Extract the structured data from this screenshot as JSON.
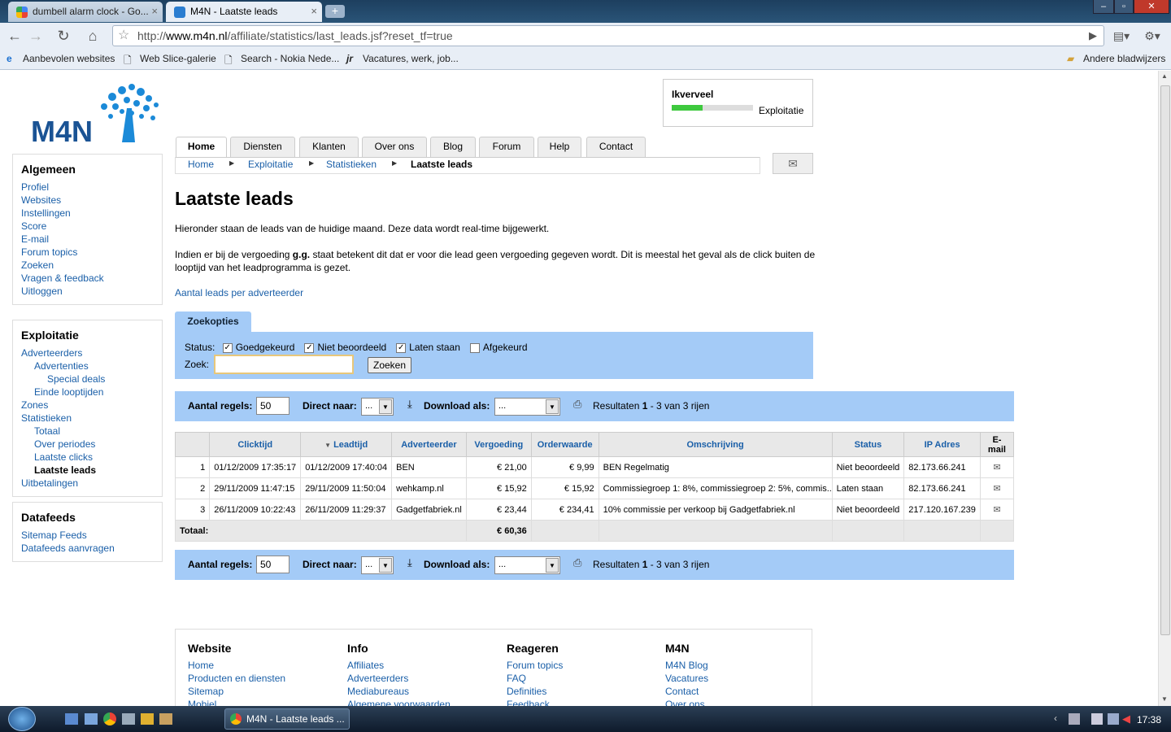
{
  "browser": {
    "tabs": [
      {
        "title": "dumbell alarm clock - Go...",
        "active": false
      },
      {
        "title": "M4N - Laatste leads",
        "active": true
      }
    ],
    "url_prefix": "http://",
    "url_host": "www.m4n.nl",
    "url_path": "/affiliate/statistics/last_leads.jsf?reset_tf=true",
    "bookmarks": [
      "Aanbevolen websites",
      "Web Slice-galerie",
      "Search - Nokia Nede...",
      "Vacatures, werk, job..."
    ],
    "other_bookmarks": "Andere bladwijzers"
  },
  "site": {
    "logo": "M4N",
    "user_box": {
      "name": "Ikverveel",
      "level_label": "Exploitatie",
      "progress": 0.38
    },
    "nav_tabs": [
      "Home",
      "Diensten",
      "Klanten",
      "Over ons",
      "Blog",
      "Forum",
      "Help",
      "Contact"
    ],
    "breadcrumb": [
      "Home",
      "Exploitatie",
      "Statistieken",
      "Laatste leads"
    ]
  },
  "sidebar": [
    {
      "title": "Algemeen",
      "items": [
        {
          "label": "Profiel",
          "level": 1
        },
        {
          "label": "Websites",
          "level": 1
        },
        {
          "label": "Instellingen",
          "level": 1
        },
        {
          "label": "Score",
          "level": 1
        },
        {
          "label": "E-mail",
          "level": 1
        },
        {
          "label": "Forum topics",
          "level": 1
        },
        {
          "label": "Zoeken",
          "level": 1
        },
        {
          "label": "Vragen & feedback",
          "level": 1
        },
        {
          "label": "Uitloggen",
          "level": 1
        }
      ]
    },
    {
      "title": "Exploitatie",
      "items": [
        {
          "label": "Adverteerders",
          "level": 1
        },
        {
          "label": "Advertenties",
          "level": 2
        },
        {
          "label": "Special deals",
          "level": 3
        },
        {
          "label": "Einde looptijden",
          "level": 2
        },
        {
          "label": "Zones",
          "level": 1
        },
        {
          "label": "Statistieken",
          "level": 1
        },
        {
          "label": "Totaal",
          "level": 2
        },
        {
          "label": "Over periodes",
          "level": 2
        },
        {
          "label": "Laatste clicks",
          "level": 2
        },
        {
          "label": "Laatste leads",
          "level": 2,
          "current": true
        },
        {
          "label": "Uitbetalingen",
          "level": 1
        }
      ]
    },
    {
      "title": "Datafeeds",
      "items": [
        {
          "label": "Sitemap Feeds",
          "level": 1
        },
        {
          "label": "Datafeeds aanvragen",
          "level": 1
        }
      ]
    }
  ],
  "main": {
    "title": "Laatste leads",
    "intro1": "Hieronder staan de leads van de huidige maand. Deze data wordt real-time bijgewerkt.",
    "intro2_pre": "Indien er bij de vergoeding ",
    "intro2_bold": "g.g.",
    "intro2_post": " staat betekent dit dat er voor die lead geen vergoeding gegeven wordt. Dit is meestal het geval als de click buiten de looptijd van het leadprogramma is gezet.",
    "link_per_adv": "Aantal leads per adverteerder",
    "search": {
      "tab": "Zoekopties",
      "status_label": "Status:",
      "options": [
        {
          "label": "Goedgekeurd",
          "checked": true
        },
        {
          "label": "Niet beoordeeld",
          "checked": true
        },
        {
          "label": "Laten staan",
          "checked": true
        },
        {
          "label": "Afgekeurd",
          "checked": false
        }
      ],
      "zoek_label": "Zoek:",
      "zoek_value": "",
      "button": "Zoeken"
    },
    "controls": {
      "rows_label": "Aantal regels:",
      "rows_value": "50",
      "direct_label": "Direct naar:",
      "direct_value": "...",
      "download_label": "Download als:",
      "download_value": "...",
      "results_pre": "Resultaten ",
      "results_bold": "1",
      "results_post": " - 3 van 3 rijen"
    },
    "table": {
      "headers": [
        "",
        "Clicktijd",
        "Leadtijd",
        "Adverteerder",
        "Vergoeding",
        "Orderwaarde",
        "Omschrijving",
        "Status",
        "IP Adres",
        "E-mail"
      ],
      "sort_indicator": "▼",
      "rows": [
        [
          "1",
          "01/12/2009 17:35:17",
          "01/12/2009 17:40:04",
          "BEN",
          "€ 21,00",
          "€ 9,99",
          "BEN Regelmatig",
          "Niet beoordeeld",
          "82.173.66.241"
        ],
        [
          "2",
          "29/11/2009 11:47:15",
          "29/11/2009 11:50:04",
          "wehkamp.nl",
          "€ 15,92",
          "€ 15,92",
          "Commissiegroep 1: 8%, commissiegroep 2: 5%, commis...",
          "Laten staan",
          "82.173.66.241"
        ],
        [
          "3",
          "26/11/2009 10:22:43",
          "26/11/2009 11:29:37",
          "Gadgetfabriek.nl",
          "€ 23,44",
          "€ 234,41",
          "10% commissie per verkoop bij Gadgetfabriek.nl",
          "Niet beoordeeld",
          "217.120.167.239"
        ]
      ],
      "total_label": "Totaal:",
      "total_value": "€ 60,36"
    }
  },
  "footer": [
    {
      "title": "Website",
      "items": [
        "Home",
        "Producten en diensten",
        "Sitemap",
        "Mobiel"
      ]
    },
    {
      "title": "Info",
      "items": [
        "Affiliates",
        "Adverteerders",
        "Mediabureaus",
        "Algemene voorwaarden"
      ]
    },
    {
      "title": "Reageren",
      "items": [
        "Forum topics",
        "FAQ",
        "Definities",
        "Feedback"
      ]
    },
    {
      "title": "M4N",
      "items": [
        "M4N Blog",
        "Vacatures",
        "Contact",
        "Over ons"
      ]
    }
  ],
  "taskbar": {
    "window_title": "M4N - Laatste leads ...",
    "clock": "17:38"
  },
  "colors": {
    "link": "#1a5fa8",
    "panel": "#a4cbf7",
    "progress": "#3ec93e"
  }
}
